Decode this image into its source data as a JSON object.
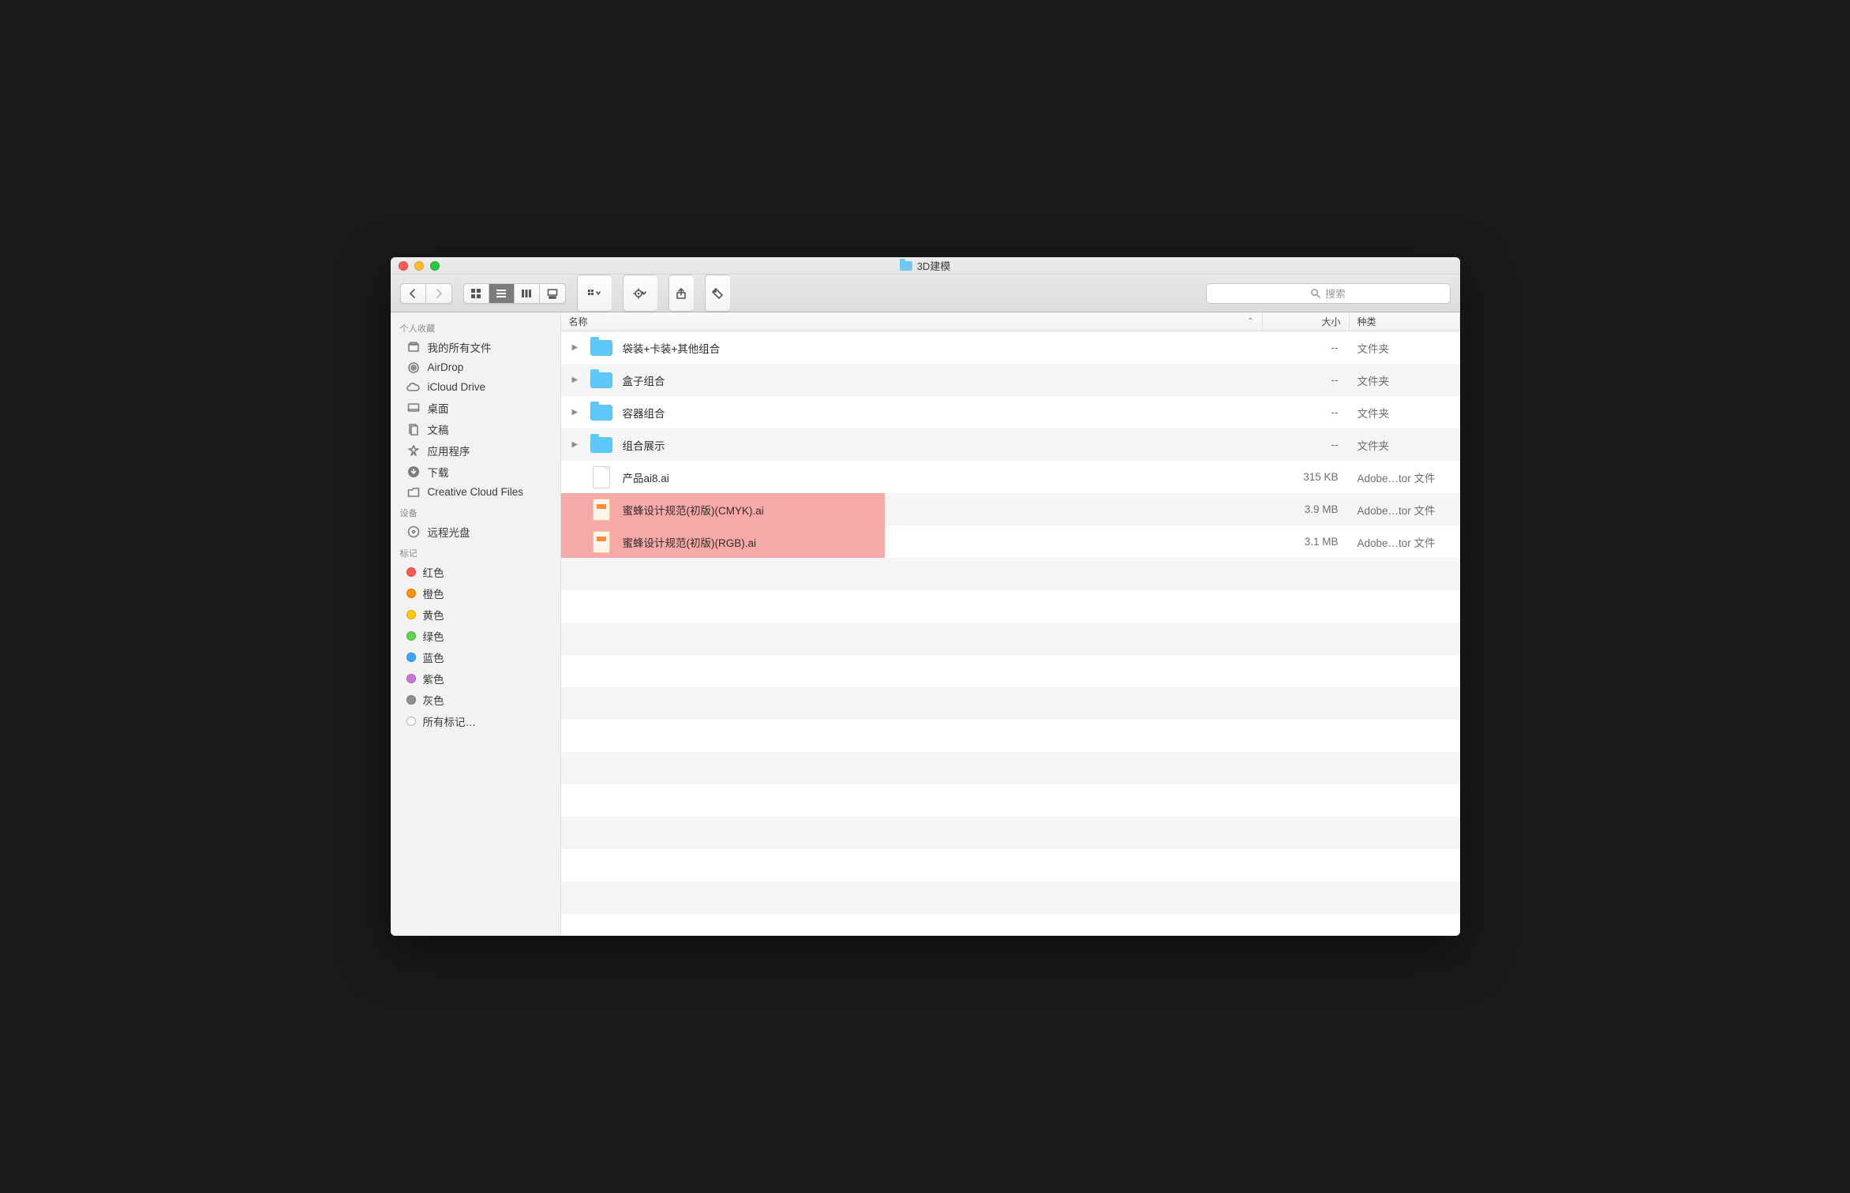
{
  "window": {
    "title": "3D建模"
  },
  "toolbar": {
    "search_placeholder": "搜索"
  },
  "columns": {
    "name": "名称",
    "size": "大小",
    "kind": "种类"
  },
  "sidebar": {
    "favorites_heading": "个人收藏",
    "favorites": [
      {
        "icon": "all-files",
        "label": "我的所有文件"
      },
      {
        "icon": "airdrop",
        "label": "AirDrop"
      },
      {
        "icon": "icloud",
        "label": "iCloud Drive"
      },
      {
        "icon": "desktop",
        "label": "桌面"
      },
      {
        "icon": "documents",
        "label": "文稿"
      },
      {
        "icon": "apps",
        "label": "应用程序"
      },
      {
        "icon": "downloads",
        "label": "下载"
      },
      {
        "icon": "folder",
        "label": "Creative Cloud Files"
      }
    ],
    "devices_heading": "设备",
    "devices": [
      {
        "icon": "disc",
        "label": "远程光盘"
      }
    ],
    "tags_heading": "标记",
    "tags": [
      {
        "color": "red",
        "label": "红色"
      },
      {
        "color": "orange",
        "label": "橙色"
      },
      {
        "color": "yellow",
        "label": "黄色"
      },
      {
        "color": "green",
        "label": "绿色"
      },
      {
        "color": "blue",
        "label": "蓝色"
      },
      {
        "color": "purple",
        "label": "紫色"
      },
      {
        "color": "gray",
        "label": "灰色"
      },
      {
        "color": "outline",
        "label": "所有标记…"
      }
    ]
  },
  "rows": [
    {
      "type": "folder",
      "name": "袋装+卡装+其他组合",
      "size": "--",
      "kind": "文件夹",
      "highlighted": false
    },
    {
      "type": "folder",
      "name": "盒子组合",
      "size": "--",
      "kind": "文件夹",
      "highlighted": false
    },
    {
      "type": "folder",
      "name": "容器组合",
      "size": "--",
      "kind": "文件夹",
      "highlighted": false
    },
    {
      "type": "folder",
      "name": "组合展示",
      "size": "--",
      "kind": "文件夹",
      "highlighted": false
    },
    {
      "type": "file",
      "name": "产品ai8.ai",
      "size": "315 KB",
      "kind": "Adobe…tor 文件",
      "highlighted": false
    },
    {
      "type": "ai",
      "name": "蜜蜂设计规范(初版)(CMYK).ai",
      "size": "3.9 MB",
      "kind": "Adobe…tor 文件",
      "highlighted": true
    },
    {
      "type": "ai",
      "name": "蜜蜂设计规范(初版)(RGB).ai",
      "size": "3.1 MB",
      "kind": "Adobe…tor 文件",
      "highlighted": true
    }
  ]
}
